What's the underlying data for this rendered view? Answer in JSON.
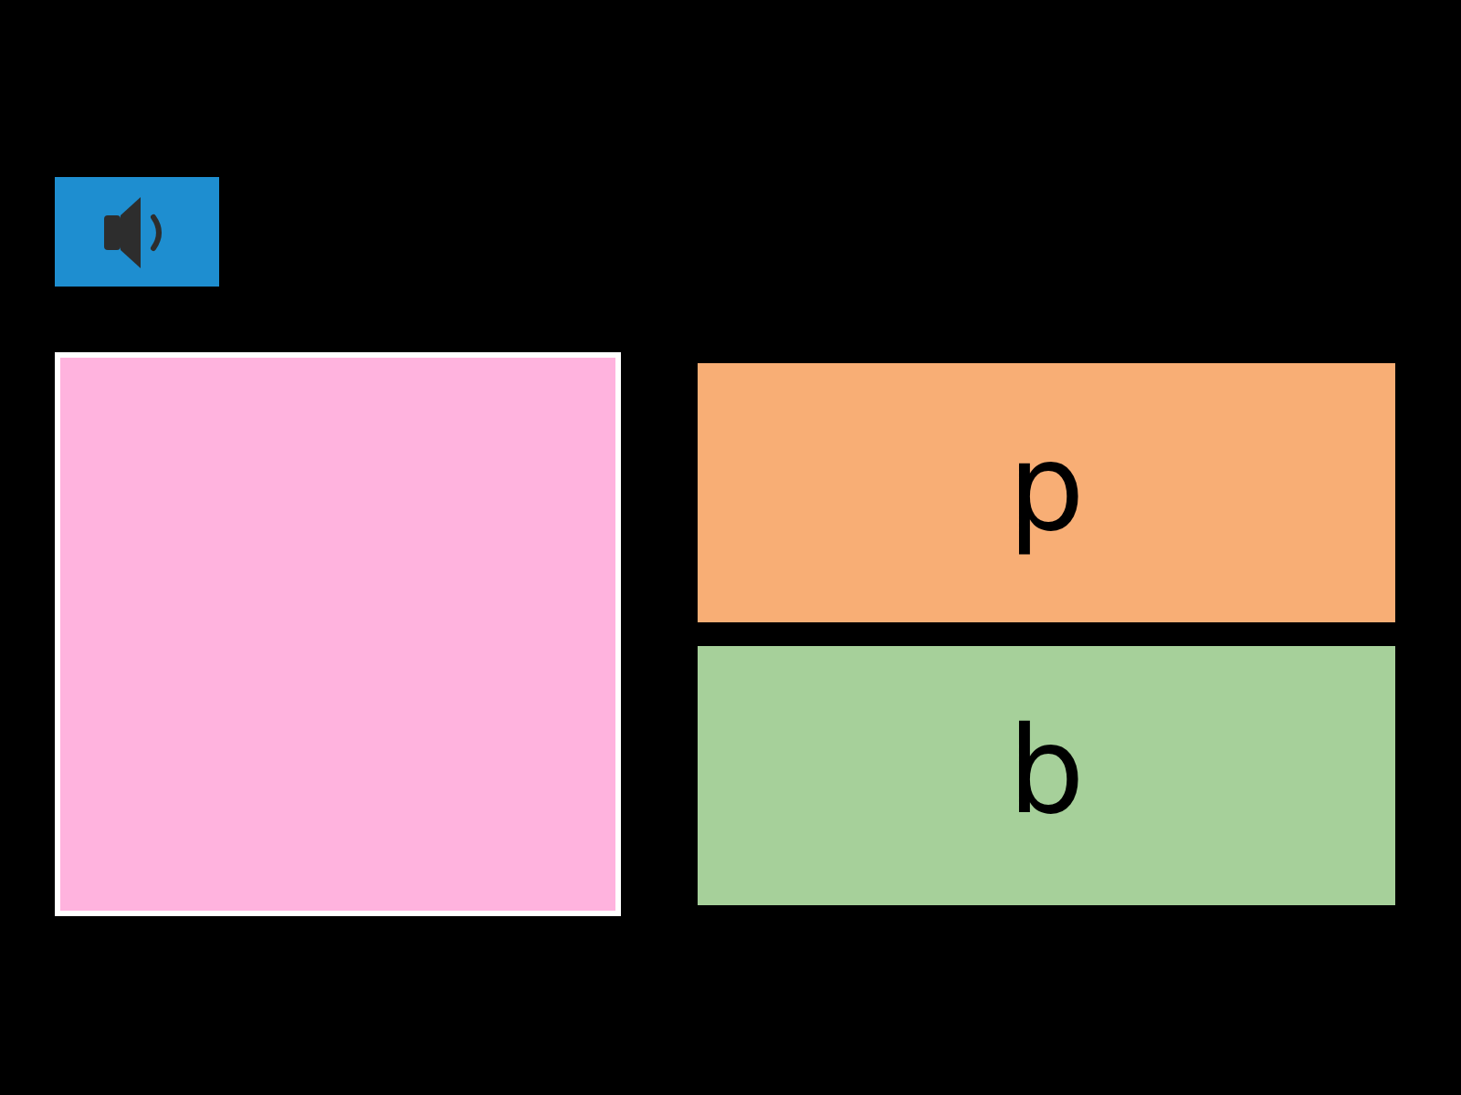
{
  "options": [
    {
      "label": "p",
      "color": "#f8ae75"
    },
    {
      "label": "b",
      "color": "#a6d09a"
    }
  ]
}
